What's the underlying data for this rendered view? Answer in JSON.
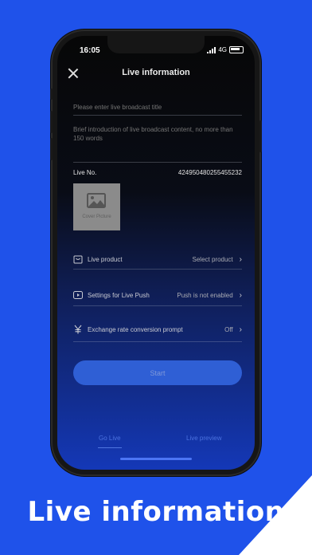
{
  "status_bar": {
    "time": "16:05",
    "network": "4G"
  },
  "header": {
    "title": "Live information"
  },
  "form": {
    "title_placeholder": "Please enter live broadcast title",
    "description_placeholder": "Brief introduction of live broadcast content, no more than 150 words",
    "live_no_label": "Live No.",
    "live_no_value": "424950480255455232",
    "cover_label": "Cover Picture"
  },
  "settings": [
    {
      "label": "Live product",
      "value": "Select product",
      "icon": "bag-icon"
    },
    {
      "label": "Settings for Live Push",
      "value": "Push is not enabled",
      "icon": "play-icon"
    },
    {
      "label": "Exchange rate conversion prompt",
      "value": "Off",
      "icon": "yen-icon"
    }
  ],
  "start_label": "Start",
  "tabs": {
    "go_live": "Go Live",
    "live_preview": "Live preview"
  },
  "caption": "Live information",
  "colors": {
    "background": "#1f52ea",
    "start_button": "#2f5fd5"
  }
}
